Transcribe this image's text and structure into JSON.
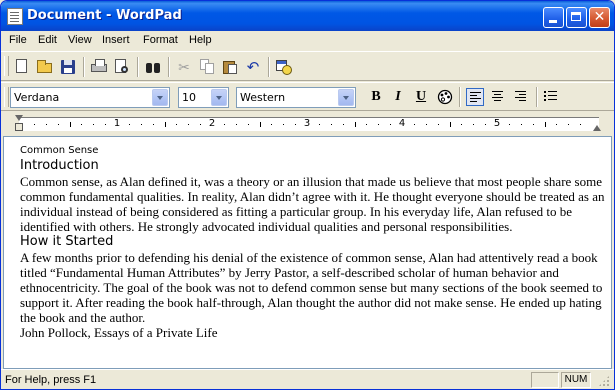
{
  "window": {
    "title": "Document - WordPad"
  },
  "menu": [
    "File",
    "Edit",
    "View",
    "Insert",
    "Format",
    "Help"
  ],
  "toolbar": {
    "icons": [
      "new-document-icon",
      "open-folder-icon",
      "save-disk-icon",
      "print-icon",
      "print-preview-icon",
      "find-binoculars-icon",
      "cut-scissors-icon",
      "copy-icon",
      "paste-icon",
      "undo-icon",
      "date-time-icon"
    ]
  },
  "format_bar": {
    "font": "Verdana",
    "size": "10",
    "script": "Western",
    "bold": "B",
    "italic": "I",
    "underline": "U",
    "alignment": "left"
  },
  "ruler": {
    "numbers": [
      "1",
      "2",
      "3",
      "4",
      "5"
    ]
  },
  "document": {
    "title": "Common Sense",
    "heading1": "Introduction",
    "para1": "Common sense, as Alan defined it, was a theory or an illusion that made us believe that most people share some common fundamental qualities. In reality, Alan didn’t agree with it. He thought everyone should be treated as an individual instead of being considered as fitting a particular group. In his everyday life, Alan refused to be identified with others. He strongly advocated individual qualities and personal responsibilities.",
    "heading2": "How it Started",
    "para2": "A few months prior to defending his denial of the existence of common sense, Alan had attentively read a book titled “Fundamental Human Attributes” by Jerry Pastor, a self-described scholar of human behavior and ethnocentricity. The goal of the book was not to defend common sense but many sections of the book seemed to support it. After reading the book half-through, Alan thought the author did not make sense. He ended up hating the book and the author.",
    "signature": "John Pollock, Essays of a Private Life"
  },
  "status": {
    "help_text": "For Help, press F1",
    "num": "NUM"
  },
  "colors": {
    "title_bar": "#0054e3",
    "close_button": "#d65a32",
    "chrome": "#ece9d8"
  }
}
